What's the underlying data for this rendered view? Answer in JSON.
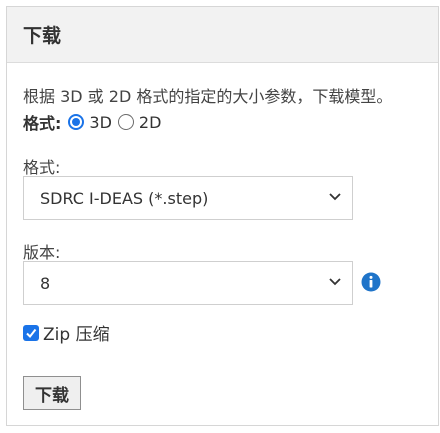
{
  "panel": {
    "title": "下载",
    "description": "根据 3D 或 2D 格式的指定的大小参数，下载模型。"
  },
  "format_type": {
    "label": "格式:",
    "options": [
      "3D",
      "2D"
    ],
    "selected": "3D"
  },
  "format": {
    "label": "格式:",
    "value": "SDRC I-DEAS (*.step)"
  },
  "version": {
    "label": "版本:",
    "value": "8"
  },
  "zip": {
    "label": "Zip 压缩",
    "checked": true
  },
  "download_button": {
    "label": "下载"
  },
  "colors": {
    "accent": "#1a73e8",
    "header_bg": "#f2f2f2",
    "info_icon": "#1f74c9"
  },
  "icons": [
    "chevron-down-icon",
    "info-icon",
    "checkmark-icon"
  ]
}
